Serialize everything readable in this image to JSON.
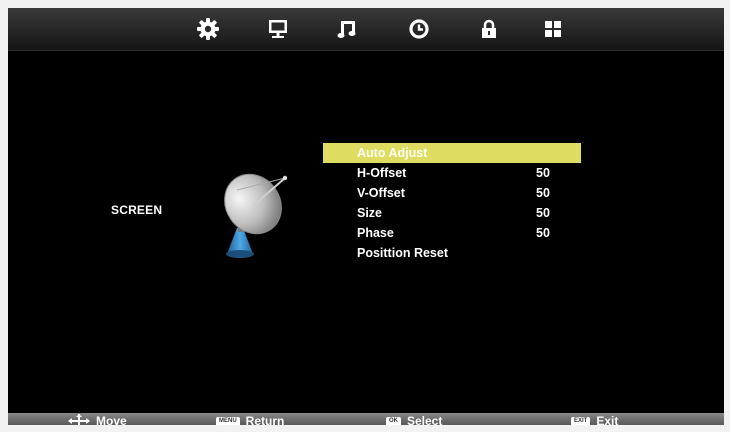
{
  "topbar": {
    "tabs": [
      {
        "icon": "gear-icon"
      },
      {
        "icon": "monitor-icon"
      },
      {
        "icon": "music-note-icon"
      },
      {
        "icon": "clock-icon"
      },
      {
        "icon": "lock-icon"
      },
      {
        "icon": "grid-icon"
      }
    ]
  },
  "category": {
    "label": "SCREEN",
    "icon": "satellite-dish-icon"
  },
  "menu": {
    "items": [
      {
        "label": "Auto Adjust",
        "value": ""
      },
      {
        "label": "H-Offset",
        "value": "50"
      },
      {
        "label": "V-Offset",
        "value": "50"
      },
      {
        "label": "Size",
        "value": "50"
      },
      {
        "label": "Phase",
        "value": "50"
      },
      {
        "label": "Posittion  Reset",
        "value": ""
      }
    ],
    "selected_index": 0,
    "highlight_color": "#dedd61"
  },
  "footer": {
    "move": {
      "label": "Move",
      "icon": "dpad-arrows-icon"
    },
    "return": {
      "label": "Return",
      "key": "MENU"
    },
    "select": {
      "label": "Select",
      "key": "OK"
    },
    "exit": {
      "label": "Exit",
      "key": "EXIT"
    }
  }
}
